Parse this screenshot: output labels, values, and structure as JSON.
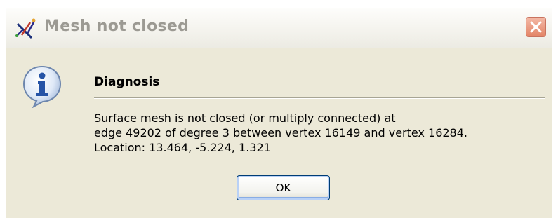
{
  "window": {
    "title": "Mesh not closed",
    "app_icon": "mesh-tool-icon",
    "close_icon": "close-icon"
  },
  "dialog": {
    "icon": "information-icon",
    "heading": "Diagnosis",
    "message_lines": [
      "Surface mesh is not closed (or multiply connected) at",
      "edge 49202 of degree 3 between vertex 16149 and vertex 16284.",
      "Location: 13.464, -5.224, 1.321"
    ],
    "ok_label": "OK"
  },
  "colors": {
    "dialog_background": "#ece9d8",
    "close_button": "#e38466",
    "title_text": "#9c9a93",
    "button_border": "#003c74"
  }
}
